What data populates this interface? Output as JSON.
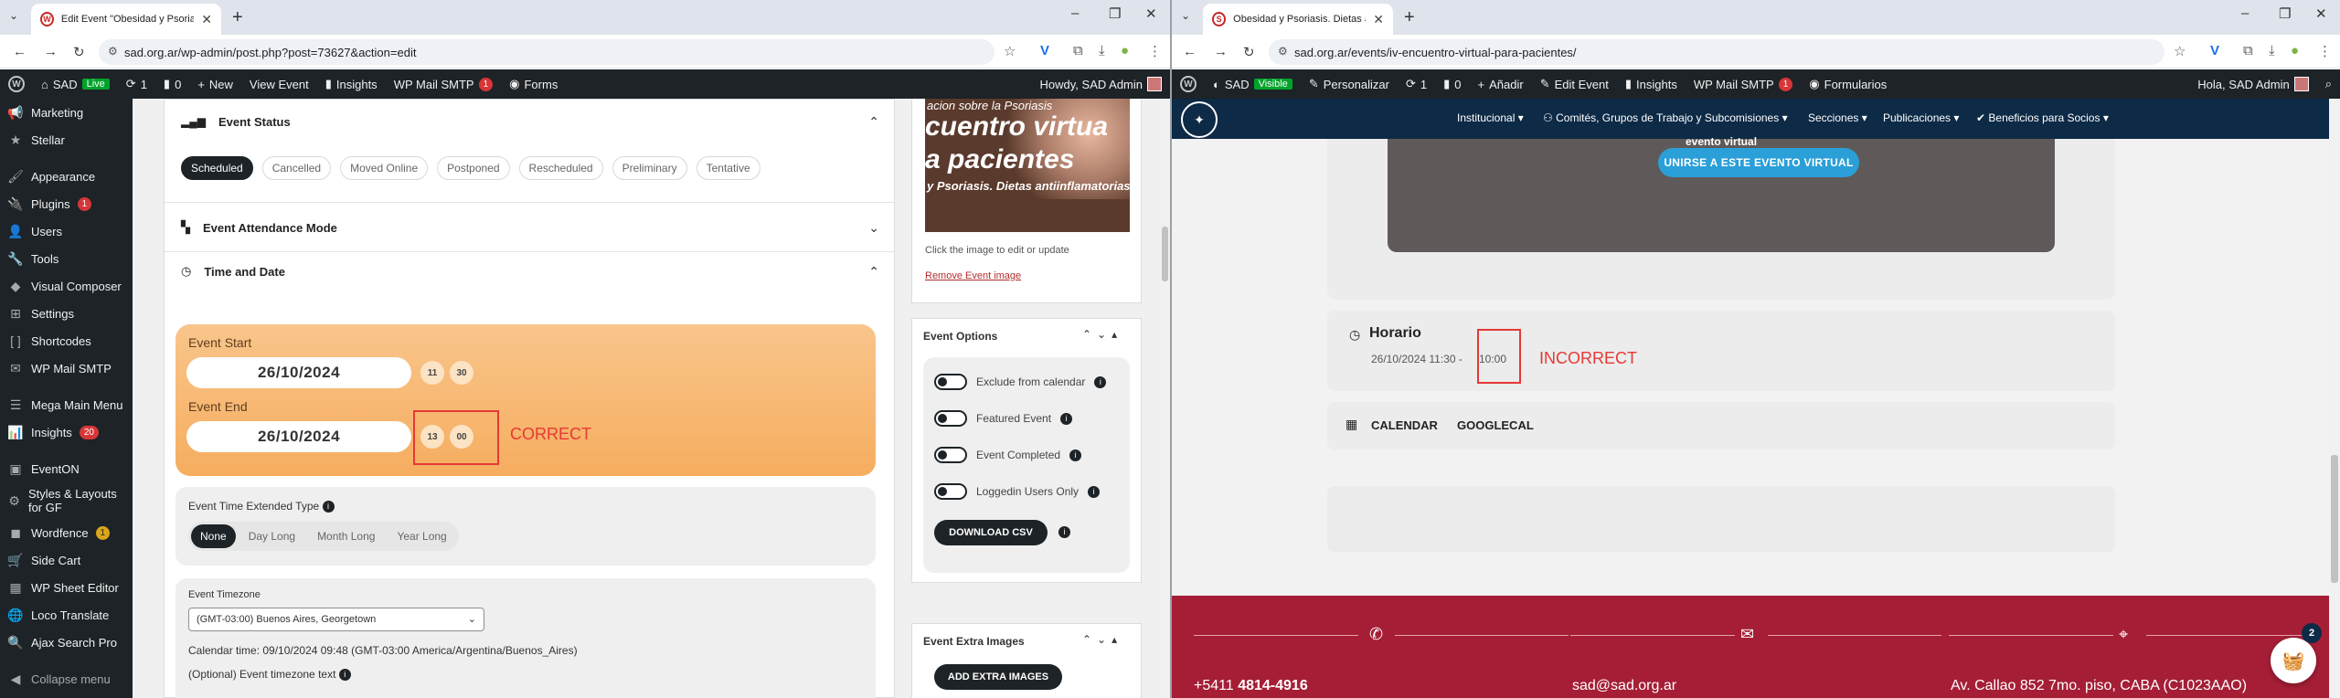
{
  "left": {
    "tab": {
      "title": "Edit Event \"Obesidad y Psoriasis",
      "favicon": "wp-favicon"
    },
    "url": "sad.org.ar/wp-admin/post.php?post=73627&action=edit",
    "adminbar": {
      "site": "SAD",
      "live": "Live",
      "updates": "1",
      "comments": "0",
      "new": "New",
      "view": "View Event",
      "insights": "Insights",
      "smtp": "WP Mail SMTP",
      "smtp_count": "1",
      "forms": "Forms",
      "howdy": "Howdy, SAD Admin"
    },
    "menu": [
      {
        "label": "Marketing",
        "icon": "megaphone-icon",
        "glyph": "📢"
      },
      {
        "label": "Stellar",
        "icon": "star-icon",
        "glyph": "★"
      },
      {
        "label": "Appearance",
        "icon": "brush-icon",
        "glyph": "🖌"
      },
      {
        "label": "Plugins",
        "icon": "plug-icon",
        "glyph": "🔌",
        "badge": "1"
      },
      {
        "label": "Users",
        "icon": "users-icon",
        "glyph": "👤"
      },
      {
        "label": "Tools",
        "icon": "wrench-icon",
        "glyph": "🔧"
      },
      {
        "label": "Visual Composer",
        "icon": "vc-icon",
        "glyph": "◆"
      },
      {
        "label": "Settings",
        "icon": "settings-icon",
        "glyph": "⊞"
      },
      {
        "label": "Shortcodes",
        "icon": "brackets-icon",
        "glyph": "[ ]"
      },
      {
        "label": "WP Mail SMTP",
        "icon": "mail-icon",
        "glyph": "✉"
      },
      {
        "label": "Mega Main Menu",
        "icon": "menu-icon",
        "glyph": "☰"
      },
      {
        "label": "Insights",
        "icon": "insights-icon",
        "glyph": "📊",
        "badge": "20"
      },
      {
        "label": "EventON",
        "icon": "eventon-icon",
        "glyph": "▣"
      },
      {
        "label": "Styles & Layouts for GF",
        "icon": "gear-icon",
        "glyph": "⚙"
      },
      {
        "label": "Wordfence",
        "icon": "wordfence-icon",
        "glyph": "◼",
        "badge": "1"
      },
      {
        "label": "Side Cart",
        "icon": "cart-icon",
        "glyph": "🛒"
      },
      {
        "label": "WP Sheet Editor",
        "icon": "sheet-icon",
        "glyph": "▦"
      },
      {
        "label": "Loco Translate",
        "icon": "translate-icon",
        "glyph": "🌐"
      },
      {
        "label": "Ajax Search Pro",
        "icon": "search-icon",
        "glyph": "🔍"
      },
      {
        "label": "Collapse menu",
        "icon": "collapse-icon",
        "glyph": "◀"
      }
    ],
    "event_status": {
      "title": "Event Status",
      "options": [
        "Scheduled",
        "Cancelled",
        "Moved Online",
        "Postponed",
        "Rescheduled",
        "Preliminary",
        "Tentative"
      ],
      "selected": "Scheduled"
    },
    "attendance": {
      "title": "Event Attendance Mode"
    },
    "time": {
      "title": "Time and Date",
      "start_label": "Event Start",
      "start_date": "26/10/2024",
      "start_hour": "11",
      "start_min": "30",
      "end_label": "Event End",
      "end_date": "26/10/2024",
      "end_hour": "13",
      "end_min": "00",
      "annotation": "CORRECT"
    },
    "extended": {
      "label": "Event Time Extended Type",
      "options": [
        "None",
        "Day Long",
        "Month Long",
        "Year Long"
      ],
      "selected": "None"
    },
    "timezone": {
      "label": "Event Timezone",
      "value": "(GMT-03:00) Buenos Aires, Georgetown",
      "calendar_time": "Calendar time: 09/10/2024 09:48 (GMT-03:00 America/Argentina/Buenos_Aires)",
      "optional": "(Optional) Event timezone text"
    },
    "image": {
      "line1": "acion sobre la Psoriasis",
      "line2": "cuentro virtua",
      "line3": "a pacientes",
      "line4": "y Psoriasis. Dietas antiinflamatorias\"",
      "help": "Click the image to edit or update",
      "remove": "Remove Event image"
    },
    "options": {
      "title": "Event Options",
      "items": [
        "Exclude from calendar",
        "Featured Event",
        "Event Completed",
        "Loggedin Users Only"
      ],
      "download": "DOWNLOAD CSV"
    },
    "extra": {
      "title": "Event Extra Images",
      "button": "ADD EXTRA IMAGES"
    }
  },
  "right": {
    "tab": {
      "title": "Obesidad y Psoriasis. Dietas an"
    },
    "url": "sad.org.ar/events/iv-encuentro-virtual-para-pacientes/",
    "adminbar": {
      "site": "SAD",
      "visible": "Visible",
      "customize": "Personalizar",
      "updates": "1",
      "comments": "0",
      "add": "Añadir",
      "edit": "Edit Event",
      "insights": "Insights",
      "smtp": "WP Mail SMTP",
      "smtp_count": "1",
      "forms": "Formularios",
      "howdy": "Hola, SAD Admin"
    },
    "nav": [
      "Institucional",
      "Comités, Grupos de Trabajo y Subcomisiones",
      "Secciones",
      "Publicaciones",
      "Beneficios para Socios"
    ],
    "join": "UNIRSE A ESTE EVENTO VIRTUAL",
    "video_partial": "evento virtual",
    "horario": {
      "title": "Horario",
      "start": "26/10/2024 11:30 -",
      "end": "10:00",
      "annotation": "INCORRECT"
    },
    "calendar": [
      "CALENDAR",
      "GOOGLECAL"
    ],
    "footer": {
      "phone_prefix": "+5411 ",
      "phone": "4814-4916",
      "email": "sad@sad.org.ar",
      "address": "Av. Callao 852 7mo. piso, CABA (C1023AAO)"
    },
    "cart_count": "2"
  },
  "colors": {
    "admin_dark": "#1d2327",
    "accent_orange": "#f6ad5f",
    "annotation_red": "#e53935",
    "site_navy": "#0d2a46",
    "footer_red": "#a51e36",
    "join_blue": "#2a9fd8"
  }
}
